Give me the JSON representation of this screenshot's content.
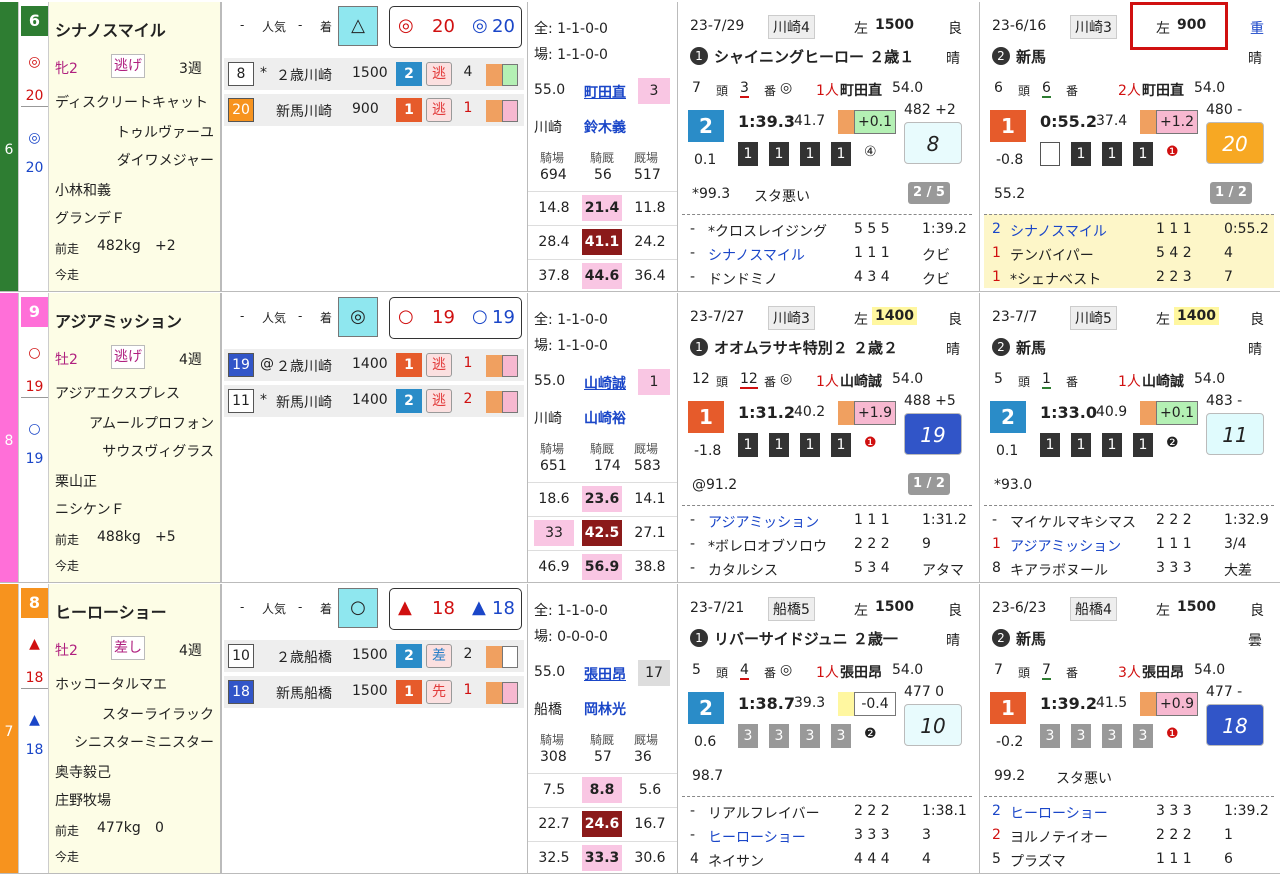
{
  "colors": {
    "waku6": "#2e7d32",
    "waku8": "#ff6fd8",
    "waku7": "#f7931e",
    "highlight": "#d01010"
  },
  "horses": [
    {
      "waku": "6",
      "num": "6",
      "mark1": "◎",
      "mark1_num": "20",
      "mark2": "◎",
      "mark2_num": "20",
      "name": "シナノスマイル",
      "sex_age": "牝2",
      "style": "逃げ",
      "interval": "3週",
      "sire": "ディスクリートキャット",
      "dam": "トゥルヴァーユ",
      "damsire": "ダイワメジャー",
      "trainer": "小林和義",
      "owner": "グランデＦ",
      "prev_label": "前走",
      "weight": "482kg",
      "weight_diff": "+2",
      "today_label": "今走",
      "pop_label": "人気",
      "fin_label": "着",
      "dash1": "-",
      "dash2": "-",
      "pred_mark": "△",
      "ev1_mark": "◎",
      "ev1_num": "20",
      "ev2_mark": "◎",
      "ev2_num": "20",
      "hist": [
        {
          "rank": "8",
          "mark": "*",
          "cls": "２歳川崎",
          "dist": "1500",
          "pop": "2",
          "pos": "逃",
          "fin": "4"
        },
        {
          "rank": "20",
          "mark": "",
          "cls": "新馬川崎",
          "dist": "900",
          "pop": "1",
          "pos": "逃",
          "fin": "1"
        }
      ],
      "stats": {
        "all": "全: 1-1-0-0",
        "venue": "場: 1-1-0-0",
        "kinryo": "55.0",
        "jockey": "町田直",
        "jockey_num": "3",
        "place": "川崎",
        "trainer": "鈴木義",
        "h1": "騎場",
        "h2": "騎厩",
        "h3": "厩場",
        "v1": "694",
        "v2": "56",
        "v3": "517",
        "r1": [
          "14.8",
          "21.4",
          "11.8"
        ],
        "r2": [
          "28.4",
          "41.1",
          "24.2"
        ],
        "r3": [
          "37.8",
          "44.6",
          "36.4"
        ]
      },
      "races": [
        {
          "date": "23-7/29",
          "venue": "川崎4",
          "course": "左",
          "dist": "1500",
          "cond": "良",
          "race": "シャイニングヒーロー ２歳１",
          "weather": "晴",
          "heads": "7",
          "hlab": "頭",
          "gate": "3",
          "glab": "番",
          "gmark": "◎",
          "popn": "1人",
          "jockey": "町田直",
          "kin": "54.0",
          "fin": "2",
          "time": "1:39.3",
          "last3f": "41.7",
          "diff": "+0.1",
          "bw": "482 +2",
          "rating": "8",
          "margin": "0.1",
          "pos": [
            "1",
            "1",
            "1",
            "1"
          ],
          "posmark": "④",
          "note1": "*99.3",
          "note2": "スタ悪い",
          "frac": "2 / 5",
          "results": [
            {
              "p": "-",
              "n": "*クロスレイジング",
              "c": "5 5 5",
              "t": "1:39.2"
            },
            {
              "p": "-",
              "n": "シナノスマイル",
              "c": "1 1 1",
              "t": "クビ"
            },
            {
              "p": "-",
              "n": "ドンドミノ",
              "c": "4 3 4",
              "t": "クビ"
            }
          ]
        },
        {
          "date": "23-6/16",
          "venue": "川崎3",
          "course": "左",
          "dist": "900",
          "cond": "重",
          "race": "新馬",
          "weather": "晴",
          "heads": "6",
          "hlab": "頭",
          "gate": "6",
          "glab": "番",
          "gmark": "",
          "popn": "2人",
          "jockey": "町田直",
          "kin": "54.0",
          "fin": "1",
          "time": "0:55.2",
          "last3f": "37.4",
          "diff": "+1.2",
          "bw": "480 -",
          "rating": "20",
          "margin": "-0.8",
          "pos": [
            "",
            "1",
            "1",
            "1"
          ],
          "posmark": "❶",
          "note1": "55.2",
          "note2": "",
          "frac": "1 / 2",
          "results": [
            {
              "p": "2",
              "n": "シナノスマイル",
              "c": "1 1 1",
              "t": "0:55.2"
            },
            {
              "p": "1",
              "n": "テンバイパー",
              "c": "5 4 2",
              "t": "4"
            },
            {
              "p": "1",
              "n": "*シェナベスト",
              "c": "2 2 3",
              "t": "7"
            }
          ]
        }
      ]
    },
    {
      "waku": "8",
      "num": "9",
      "mark1": "○",
      "mark1_num": "19",
      "mark2": "○",
      "mark2_num": "19",
      "name": "アジアミッション",
      "sex_age": "牡2",
      "style": "逃げ",
      "interval": "4週",
      "sire": "アジアエクスプレス",
      "dam": "アムールプロフォン",
      "damsire": "サウスヴィグラス",
      "trainer": "栗山正",
      "owner": "ニシケンＦ",
      "prev_label": "前走",
      "weight": "488kg",
      "weight_diff": "+5",
      "today_label": "今走",
      "pop_label": "人気",
      "fin_label": "着",
      "dash1": "-",
      "dash2": "-",
      "pred_mark": "◎",
      "ev1_mark": "○",
      "ev1_num": "19",
      "ev2_mark": "○",
      "ev2_num": "19",
      "hist": [
        {
          "rank": "19",
          "mark": "@",
          "cls": "２歳川崎",
          "dist": "1400",
          "pop": "1",
          "pos": "逃",
          "fin": "1"
        },
        {
          "rank": "11",
          "mark": "*",
          "cls": "新馬川崎",
          "dist": "1400",
          "pop": "2",
          "pos": "逃",
          "fin": "2"
        }
      ],
      "stats": {
        "all": "全: 1-1-0-0",
        "venue": "場: 1-1-0-0",
        "kinryo": "55.0",
        "jockey": "山崎誠",
        "jockey_num": "1",
        "place": "川崎",
        "trainer": "山崎裕",
        "h1": "騎場",
        "h2": "騎厩",
        "h3": "厩場",
        "v1": "651",
        "v2": "174",
        "v3": "583",
        "r1": [
          "18.6",
          "23.6",
          "14.1"
        ],
        "r2": [
          "33",
          "42.5",
          "27.1"
        ],
        "r3": [
          "46.9",
          "56.9",
          "38.8"
        ]
      },
      "races": [
        {
          "date": "23-7/27",
          "venue": "川崎3",
          "course": "左",
          "dist": "1400",
          "cond": "良",
          "race": "オオムラサキ特別２ ２歳２",
          "weather": "晴",
          "heads": "12",
          "hlab": "頭",
          "gate": "12",
          "glab": "番",
          "gmark": "◎",
          "popn": "1人",
          "jockey": "山崎誠",
          "kin": "54.0",
          "fin": "1",
          "time": "1:31.2",
          "last3f": "40.2",
          "diff": "+1.9",
          "bw": "488 +5",
          "rating": "19",
          "margin": "-1.8",
          "pos": [
            "1",
            "1",
            "1",
            "1"
          ],
          "posmark": "❶",
          "note1": "@91.2",
          "note2": "",
          "frac": "1 / 2",
          "results": [
            {
              "p": "-",
              "n": "アジアミッション",
              "c": "1 1 1",
              "t": "1:31.2"
            },
            {
              "p": "-",
              "n": "*ボレロオブソロウ",
              "c": "2 2 2",
              "t": "9"
            },
            {
              "p": "-",
              "n": "カタルシス",
              "c": "5 3 4",
              "t": "アタマ"
            }
          ]
        },
        {
          "date": "23-7/7",
          "venue": "川崎5",
          "course": "左",
          "dist": "1400",
          "cond": "良",
          "race": "新馬",
          "weather": "晴",
          "heads": "5",
          "hlab": "頭",
          "gate": "1",
          "glab": "番",
          "gmark": "",
          "popn": "1人",
          "jockey": "山崎誠",
          "kin": "54.0",
          "fin": "2",
          "time": "1:33.0",
          "last3f": "40.9",
          "diff": "+0.1",
          "bw": "483 -",
          "rating": "11",
          "margin": "0.1",
          "pos": [
            "1",
            "1",
            "1",
            "1"
          ],
          "posmark": "❷",
          "note1": "*93.0",
          "note2": "",
          "frac": "",
          "results": [
            {
              "p": "-",
              "n": "マイケルマキシマス",
              "c": "2 2 2",
              "t": "1:32.9"
            },
            {
              "p": "1",
              "n": "アジアミッション",
              "c": "1 1 1",
              "t": "3/4"
            },
            {
              "p": "8",
              "n": "キアラボヌール",
              "c": "3 3 3",
              "t": "大差"
            }
          ]
        }
      ]
    },
    {
      "waku": "7",
      "num": "8",
      "mark1": "▲",
      "mark1_num": "18",
      "mark2": "▲",
      "mark2_num": "18",
      "name": "ヒーローショー",
      "sex_age": "牡2",
      "style": "差し",
      "interval": "4週",
      "sire": "ホッコータルマエ",
      "dam": "スターライラック",
      "damsire": "シニスターミニスター",
      "trainer": "奥寺毅己",
      "owner": "庄野牧場",
      "prev_label": "前走",
      "weight": "477kg",
      "weight_diff": "0",
      "today_label": "今走",
      "pop_label": "人気",
      "fin_label": "着",
      "dash1": "-",
      "dash2": "-",
      "pred_mark": "○",
      "ev1_mark": "▲",
      "ev1_num": "18",
      "ev2_mark": "▲",
      "ev2_num": "18",
      "hist": [
        {
          "rank": "10",
          "mark": "",
          "cls": "２歳船橋",
          "dist": "1500",
          "pop": "2",
          "pos": "差",
          "fin": "2"
        },
        {
          "rank": "18",
          "mark": "",
          "cls": "新馬船橋",
          "dist": "1500",
          "pop": "1",
          "pos": "先",
          "fin": "1"
        }
      ],
      "stats": {
        "all": "全: 1-1-0-0",
        "venue": "場: 0-0-0-0",
        "kinryo": "55.0",
        "jockey": "張田昂",
        "jockey_num": "17",
        "place": "船橋",
        "trainer": "岡林光",
        "h1": "騎場",
        "h2": "騎厩",
        "h3": "厩場",
        "v1": "308",
        "v2": "57",
        "v3": "36",
        "r1": [
          "7.5",
          "8.8",
          "5.6"
        ],
        "r2": [
          "22.7",
          "24.6",
          "16.7"
        ],
        "r3": [
          "32.5",
          "33.3",
          "30.6"
        ]
      },
      "races": [
        {
          "date": "23-7/21",
          "venue": "船橋5",
          "course": "左",
          "dist": "1500",
          "cond": "良",
          "race": "リバーサイドジュニ ２歳一",
          "weather": "晴",
          "heads": "5",
          "hlab": "頭",
          "gate": "4",
          "glab": "番",
          "gmark": "◎",
          "popn": "1人",
          "jockey": "張田昂",
          "kin": "54.0",
          "fin": "2",
          "time": "1:38.7",
          "last3f": "39.3",
          "diff": "-0.4",
          "bw": "477 0",
          "rating": "10",
          "margin": "0.6",
          "pos": [
            "3",
            "3",
            "3",
            "3"
          ],
          "posmark": "❷",
          "note1": "98.7",
          "note2": "",
          "frac": "",
          "results": [
            {
              "p": "-",
              "n": "リアルフレイバー",
              "c": "2 2 2",
              "t": "1:38.1"
            },
            {
              "p": "-",
              "n": "ヒーローショー",
              "c": "3 3 3",
              "t": "3"
            },
            {
              "p": "4",
              "n": "ネイサン",
              "c": "4 4 4",
              "t": "4"
            }
          ]
        },
        {
          "date": "23-6/23",
          "venue": "船橋4",
          "course": "左",
          "dist": "1500",
          "cond": "良",
          "race": "新馬",
          "weather": "曇",
          "heads": "7",
          "hlab": "頭",
          "gate": "7",
          "glab": "番",
          "gmark": "",
          "popn": "3人",
          "jockey": "張田昂",
          "kin": "54.0",
          "fin": "1",
          "time": "1:39.2",
          "last3f": "41.5",
          "diff": "+0.9",
          "bw": "477 -",
          "rating": "18",
          "margin": "-0.2",
          "pos": [
            "3",
            "3",
            "3",
            "3"
          ],
          "posmark": "❶",
          "note1": "99.2",
          "note2": "スタ悪い",
          "frac": "",
          "results": [
            {
              "p": "2",
              "n": "ヒーローショー",
              "c": "3 3 3",
              "t": "1:39.2"
            },
            {
              "p": "2",
              "n": "ヨルノテイオー",
              "c": "2 2 2",
              "t": "1"
            },
            {
              "p": "5",
              "n": "プラズマ",
              "c": "1 1 1",
              "t": "6"
            }
          ]
        }
      ]
    }
  ]
}
